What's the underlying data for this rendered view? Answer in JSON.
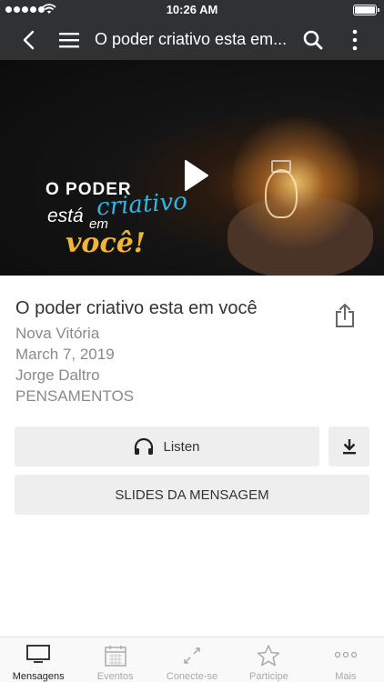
{
  "status_bar": {
    "time": "10:26 AM"
  },
  "nav": {
    "title": "O poder criativo esta em..."
  },
  "hero": {
    "brand_line1": "O PODER",
    "brand_word_criativo": "criativo",
    "brand_word_esta": "está",
    "brand_word_em": "em",
    "brand_word_voce": "você!"
  },
  "message": {
    "title": "O poder criativo esta em você",
    "location": "Nova Vitória",
    "date": "March 7, 2019",
    "speaker": "Jorge Daltro",
    "series": "PENSAMENTOS"
  },
  "actions": {
    "listen_label": "Listen",
    "slides_label": "SLIDES DA MENSAGEM"
  },
  "tabs": [
    {
      "label": "Mensagens",
      "icon": "tv-icon",
      "active": true
    },
    {
      "label": "Eventos",
      "icon": "calendar-icon",
      "active": false
    },
    {
      "label": "Conecte-se",
      "icon": "connect-arrows-icon",
      "active": false
    },
    {
      "label": "Participe",
      "icon": "star-icon",
      "active": false
    },
    {
      "label": "Mais",
      "icon": "more-dots-icon",
      "active": false
    }
  ],
  "colors": {
    "nav_bg": "#2f3133",
    "brand_blue": "#2fb6e8",
    "brand_gold": "#f2b632",
    "button_bg": "#eeeeee"
  }
}
